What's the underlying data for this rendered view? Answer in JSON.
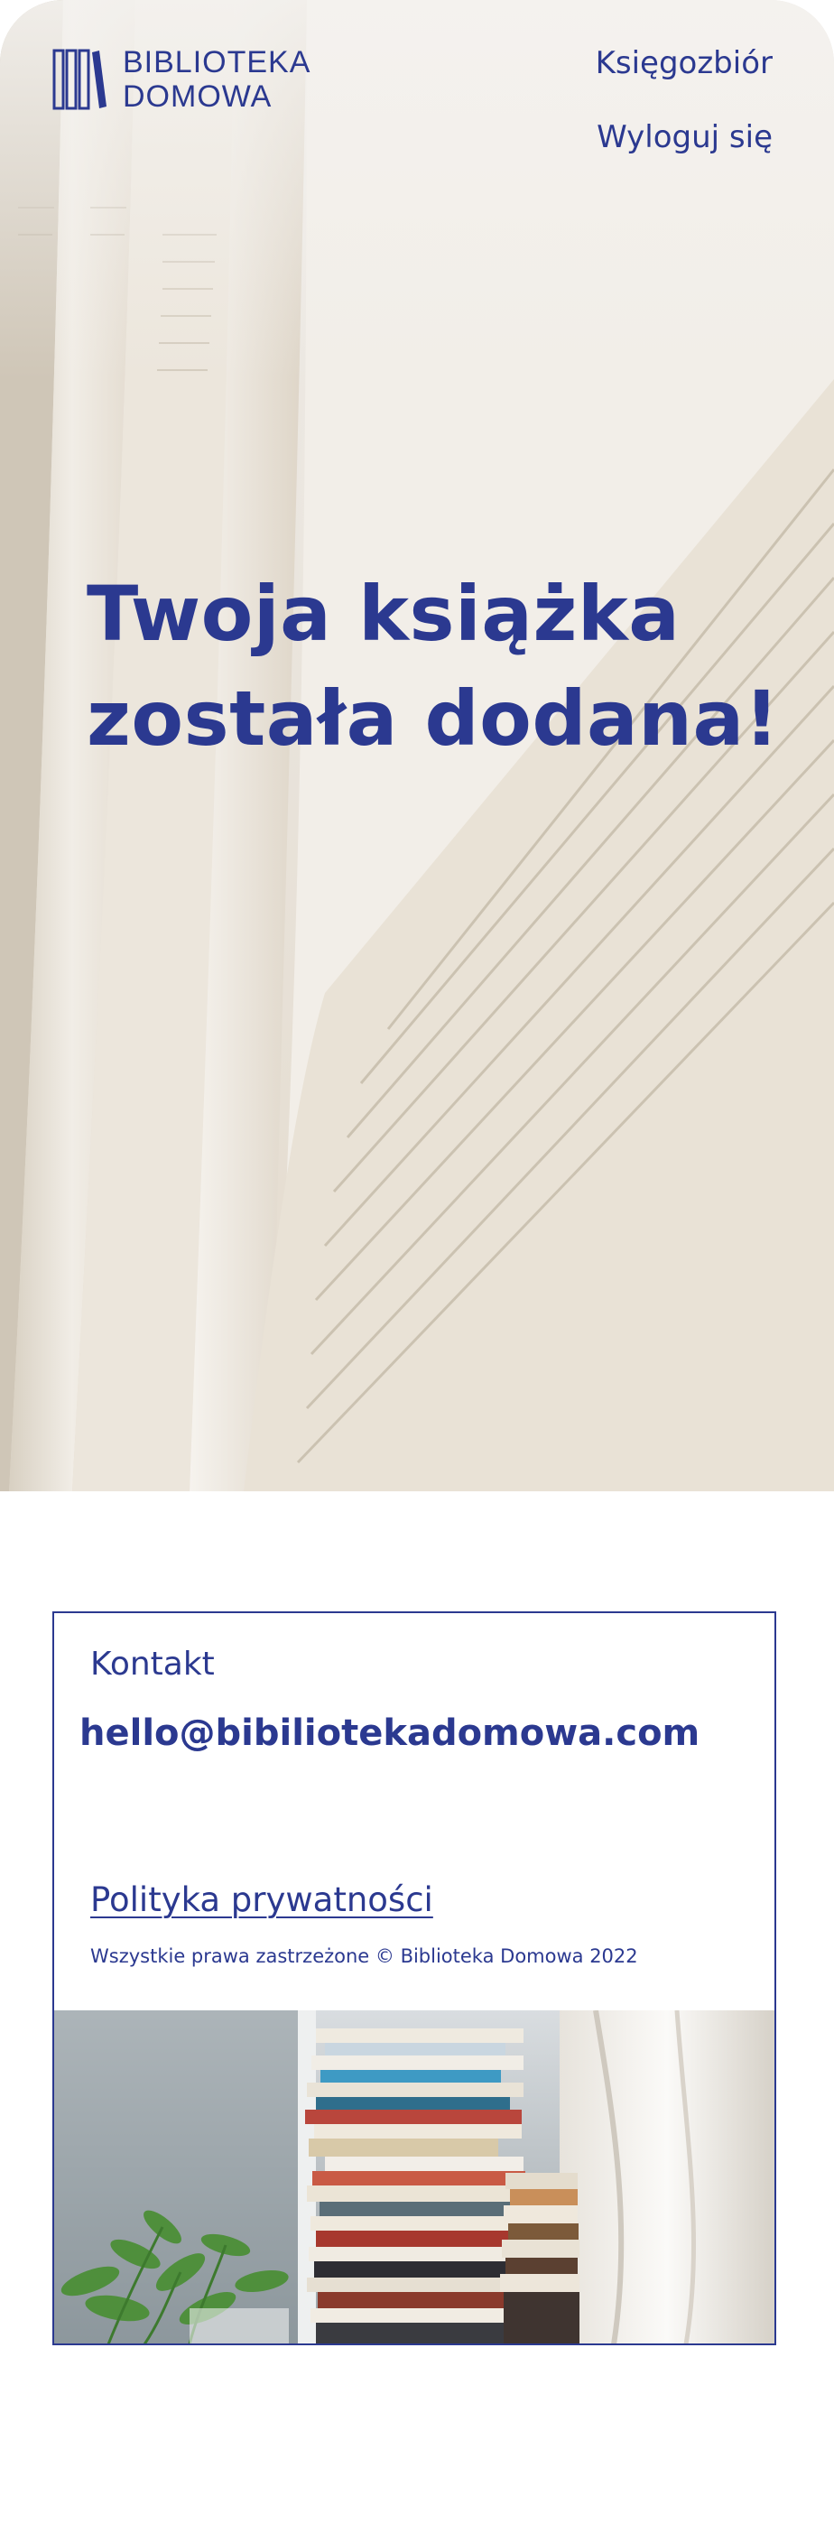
{
  "header": {
    "logo": {
      "line1": "BIBLIOTEKA",
      "line2": "DOMOWA"
    },
    "nav": [
      {
        "label": "Księgozbiór"
      },
      {
        "label": "Wyloguj się"
      }
    ]
  },
  "hero": {
    "title_line1": "Twoja książka",
    "title_line2": "została dodana!"
  },
  "footer": {
    "contact_label": "Kontakt",
    "email": "hello@bibiliotekadomowa.com",
    "privacy_label": "Polityka prywatności",
    "copyright": "Wszystkie prawa zastrzeżone © Biblioteka Domowa 2022"
  },
  "colors": {
    "brand": "#2b3990",
    "background": "#ffffff"
  }
}
